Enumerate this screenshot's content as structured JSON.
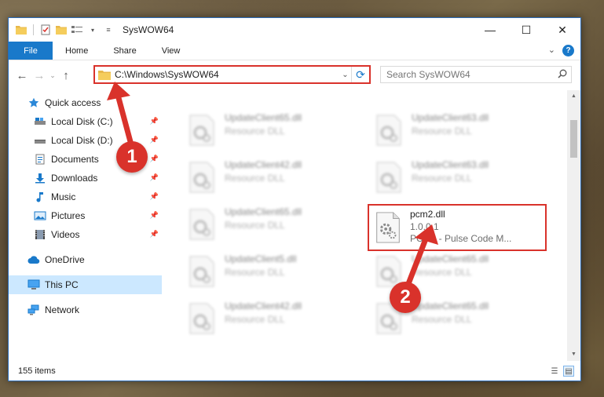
{
  "window": {
    "title": "SysWOW64",
    "controls": {
      "minimize": "—",
      "maximize": "☐",
      "close": "✕"
    }
  },
  "ribbon": {
    "tabs": [
      {
        "label": "File"
      },
      {
        "label": "Home"
      },
      {
        "label": "Share"
      },
      {
        "label": "View"
      }
    ],
    "help": "?"
  },
  "address_bar": {
    "path": "C:\\Windows\\SysWOW64"
  },
  "search": {
    "placeholder": "Search SysWOW64"
  },
  "nav_pane": {
    "quick_access": "Quick access",
    "items": [
      {
        "label": "Local Disk (C:)",
        "icon": "drive-icon"
      },
      {
        "label": "Local Disk (D:)",
        "icon": "drive-icon"
      },
      {
        "label": "Documents",
        "icon": "documents-icon"
      },
      {
        "label": "Downloads",
        "icon": "downloads-icon"
      },
      {
        "label": "Music",
        "icon": "music-icon"
      },
      {
        "label": "Pictures",
        "icon": "pictures-icon"
      },
      {
        "label": "Videos",
        "icon": "videos-icon"
      }
    ],
    "onedrive": "OneDrive",
    "this_pc": "This PC",
    "network": "Network"
  },
  "files": [
    {
      "name": "UpdateClient65.dll",
      "sub": "Resource DLL"
    },
    {
      "name": "UpdateClient63.dll",
      "sub": "Resource DLL"
    },
    {
      "name": "UpdateClient42.dll",
      "sub": "Resource DLL"
    },
    {
      "name": "UpdateClient63.dll",
      "sub": "Resource DLL"
    },
    {
      "name": "UpdateClient65.dll",
      "sub": "Resource DLL"
    },
    {
      "name": "UpdateClient5.dll",
      "sub": "Resource DLL"
    },
    {
      "name": "UpdateClient65.dll",
      "sub": "Resource DLL"
    },
    {
      "name": "UpdateClient42.dll",
      "sub": "Resource DLL"
    },
    {
      "name": "UpdateClient65.dll",
      "sub": "Resource DLL"
    }
  ],
  "highlighted_file": {
    "name": "pcm2.dll",
    "version": "1.0.0.1",
    "description": "PCM2 - Pulse Code M..."
  },
  "status": {
    "item_count": "155 items"
  },
  "annotations": {
    "step1": "1",
    "step2": "2",
    "color": "#d9322b"
  }
}
